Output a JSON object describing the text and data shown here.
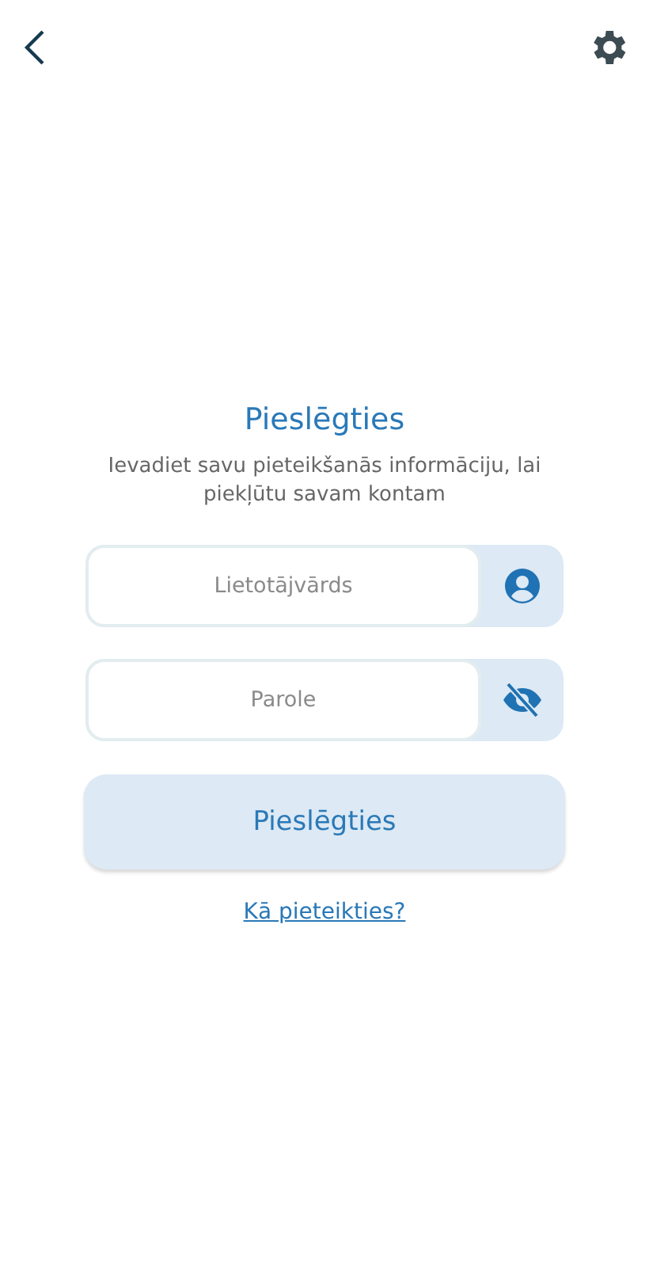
{
  "title": "Pieslēgties",
  "subtitle": "Ievadiet savu pieteikšanās informāciju, lai piekļūtu savam kontam",
  "fields": [
    {
      "placeholder": "Lietotājvārds",
      "kind": "user"
    },
    {
      "placeholder": "Parole",
      "kind": "password"
    }
  ],
  "submit": "Pieslēgties",
  "help_link": "Kā pieteikties?"
}
